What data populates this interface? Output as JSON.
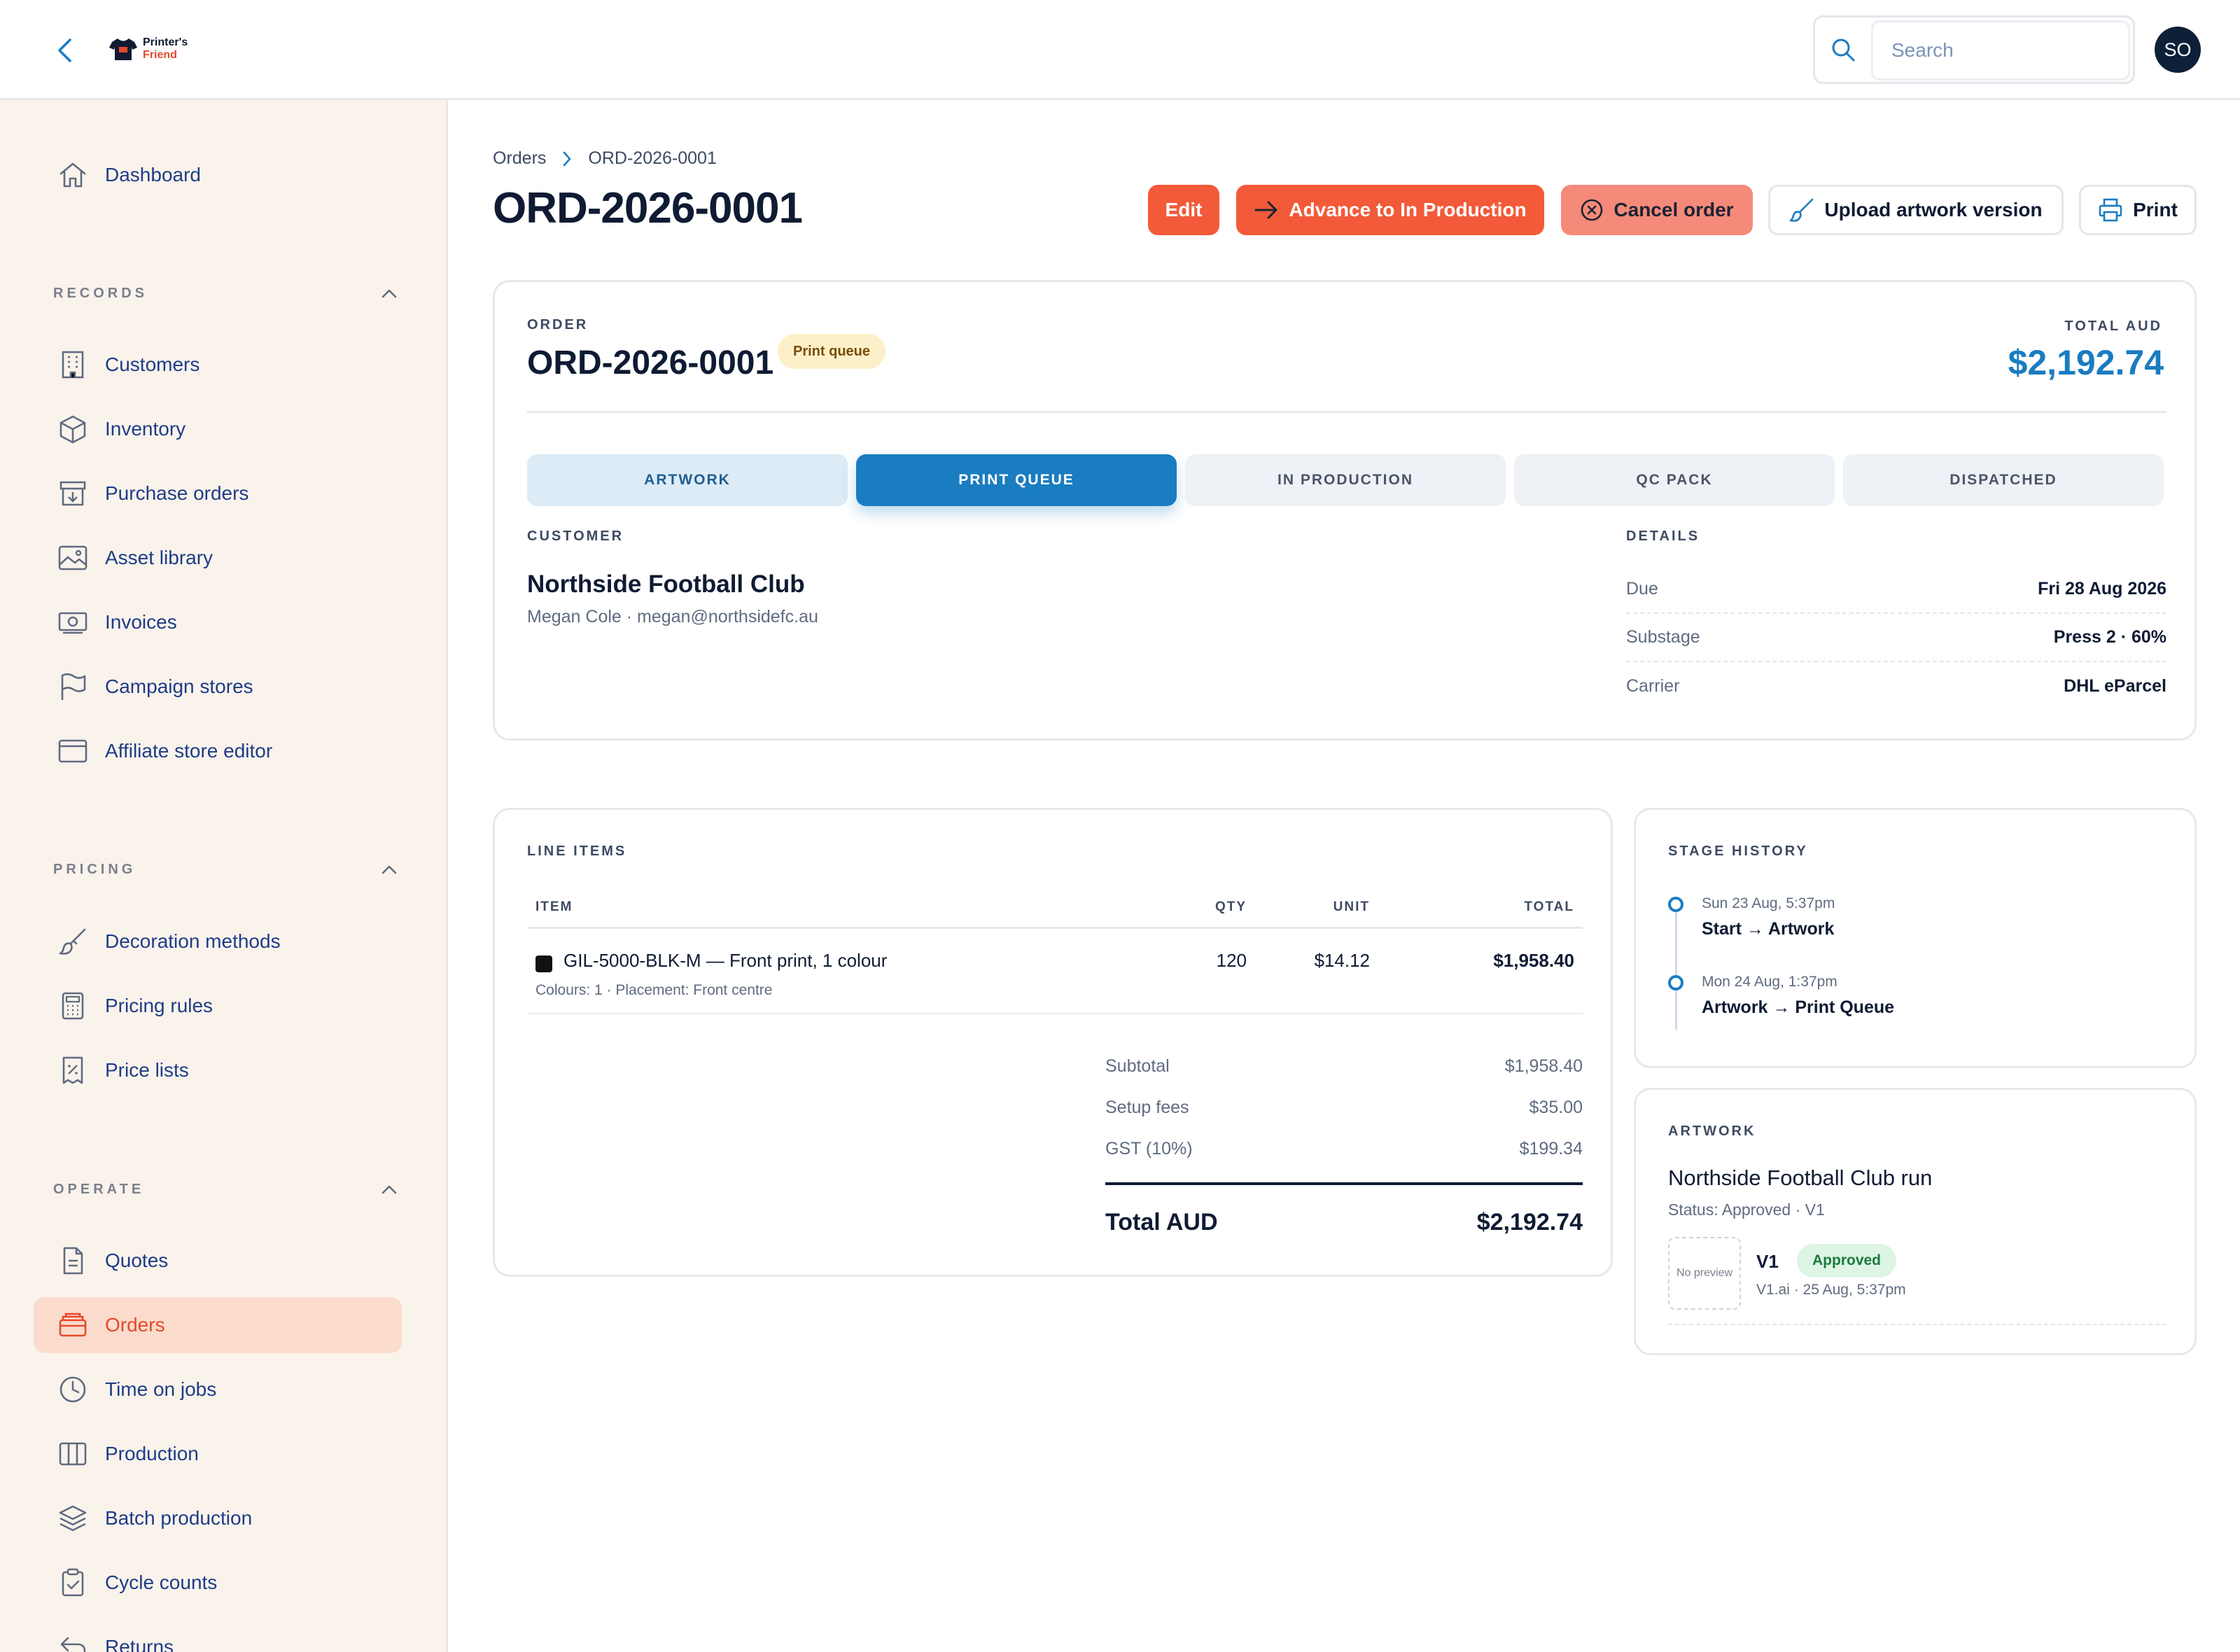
{
  "app": {
    "logo_line1": "Printer's",
    "logo_line2": "Friend"
  },
  "topbar": {
    "search_placeholder": "Search",
    "avatar_initials": "SO"
  },
  "sidebar": {
    "dashboard": "Dashboard",
    "records": {
      "title": "RECORDS",
      "items": [
        "Customers",
        "Inventory",
        "Purchase orders",
        "Asset library",
        "Invoices",
        "Campaign stores",
        "Affiliate store editor"
      ]
    },
    "pricing": {
      "title": "PRICING",
      "items": [
        "Decoration methods",
        "Pricing rules",
        "Price lists"
      ]
    },
    "operate": {
      "title": "OPERATE",
      "items": [
        "Quotes",
        "Orders",
        "Time on jobs",
        "Production",
        "Batch production",
        "Cycle counts",
        "Returns"
      ]
    }
  },
  "breadcrumb": {
    "parent": "Orders",
    "current": "ORD-2026-0001"
  },
  "page": {
    "title": "ORD-2026-0001"
  },
  "actions": {
    "edit": "Edit",
    "advance": "Advance to In Production",
    "cancel": "Cancel order",
    "upload": "Upload artwork version",
    "print": "Print"
  },
  "order": {
    "label": "ORDER",
    "number": "ORD-2026-0001",
    "status": "Print queue",
    "total_label": "TOTAL AUD",
    "total": "$2,192.74",
    "stages": [
      "ARTWORK",
      "PRINT QUEUE",
      "IN PRODUCTION",
      "QC PACK",
      "DISPATCHED"
    ],
    "customer_label": "CUSTOMER",
    "customer_name": "Northside Football Club",
    "customer_contact": "Megan Cole · megan@northsidefc.au",
    "details_label": "DETAILS",
    "details": [
      {
        "k": "Due",
        "v": "Fri 28 Aug 2026"
      },
      {
        "k": "Substage",
        "v": "Press 2 · 60%"
      },
      {
        "k": "Carrier",
        "v": "DHL eParcel"
      }
    ]
  },
  "line_items": {
    "label": "LINE ITEMS",
    "headers": {
      "item": "ITEM",
      "qty": "QTY",
      "unit": "UNIT",
      "total": "TOTAL"
    },
    "rows": [
      {
        "name": "GIL-5000-BLK-M — Front print, 1 colour",
        "sub": "Colours: 1 · Placement: Front centre",
        "qty": "120",
        "unit": "$14.12",
        "total": "$1,958.40",
        "swatch": "#0f1115"
      }
    ],
    "summary": [
      {
        "k": "Subtotal",
        "v": "$1,958.40"
      },
      {
        "k": "Setup fees",
        "v": "$35.00"
      },
      {
        "k": "GST (10%)",
        "v": "$199.34"
      }
    ],
    "total_label": "Total AUD",
    "total_value": "$2,192.74"
  },
  "stage_history": {
    "label": "STAGE HISTORY",
    "events": [
      {
        "date": "Sun 23 Aug, 5:37pm",
        "what": "Start → Artwork"
      },
      {
        "date": "Mon 24 Aug, 1:37pm",
        "what": "Artwork → Print Queue"
      }
    ]
  },
  "artwork": {
    "label": "ARTWORK",
    "title": "Northside Football Club run",
    "status": "Status: Approved · V1",
    "thumb_text": "No preview",
    "version": "V1",
    "badge": "Approved",
    "file": "V1.ai · 25 Aug, 5:37pm"
  },
  "colors": {
    "accent": "#f25a39",
    "primary": "#1a7cc1",
    "sidebar_bg": "#faf3ec",
    "nav_text": "#1f3c88"
  }
}
